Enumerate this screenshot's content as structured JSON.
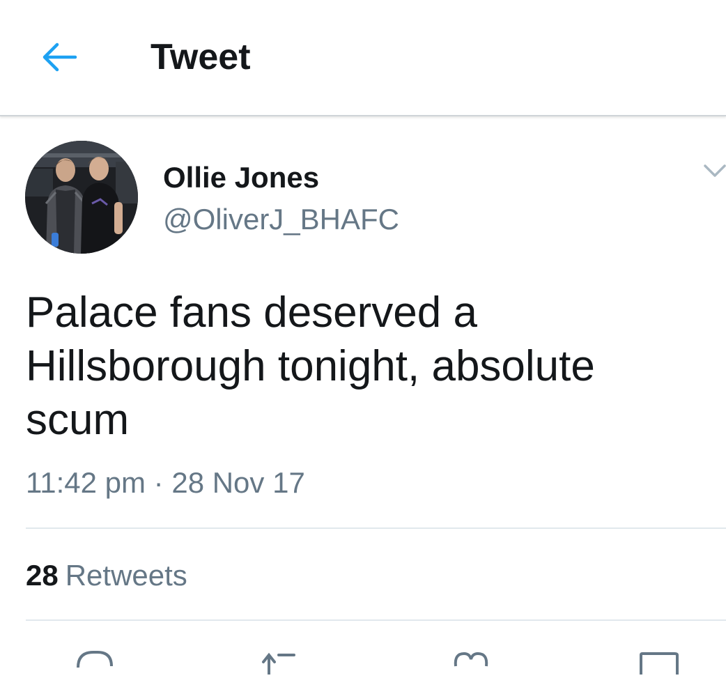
{
  "header": {
    "back_icon": "arrow-left-icon",
    "title": "Tweet"
  },
  "author": {
    "display_name": "Ollie Jones",
    "handle": "@OliverJ_BHAFC",
    "avatar": "profile-photo"
  },
  "tweet": {
    "text_lines": [
      "Palace fans deserved a",
      "Hillsborough tonight, absolute",
      "scum"
    ],
    "time": "11:42 pm",
    "separator": "·",
    "date": "28 Nov 17"
  },
  "stats": {
    "retweet_count": "28",
    "retweet_label": "Retweets"
  },
  "actions": [
    "reply-icon",
    "retweet-icon",
    "like-icon",
    "share-icon"
  ],
  "colors": {
    "accent": "#1da1f2",
    "text_primary": "#14171a",
    "text_secondary": "#657786",
    "divider": "#e1e8ed"
  }
}
